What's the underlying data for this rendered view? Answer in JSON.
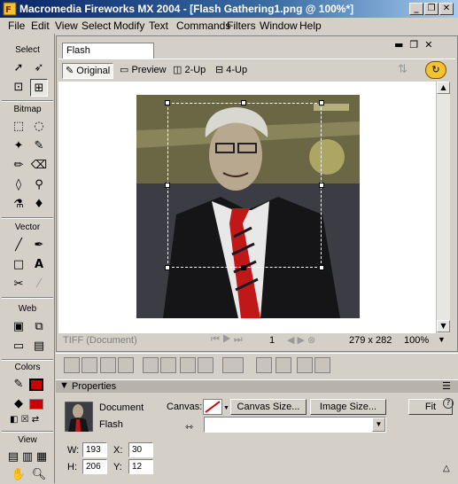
{
  "window": {
    "title": "Macromedia Fireworks MX 2004 - [Flash Gathering1.png @ 100%*]",
    "minimize_icon": "minimize-icon",
    "restore_icon": "restore-icon",
    "close_icon": "close-icon"
  },
  "menu": [
    "File",
    "Edit",
    "View",
    "Select",
    "Modify",
    "Text",
    "Commands",
    "Filters",
    "Window",
    "Help"
  ],
  "tools": {
    "sections": [
      "Select",
      "Bitmap",
      "Vector",
      "Web",
      "Colors",
      "View"
    ]
  },
  "document": {
    "tab": "Flash Gathering1.png*",
    "views": [
      "Original",
      "Preview",
      "2-Up",
      "4-Up"
    ],
    "status_left": "TIFF (Document)",
    "frame": "1",
    "dimensions": "279 x 282",
    "zoom": "100%"
  },
  "properties": {
    "header": "Properties",
    "type": "Document",
    "name": "Flash",
    "canvas_label": "Canvas:",
    "canvas_size_button": "Canvas Size...",
    "image_size_button": "Image Size...",
    "fit_button": "Fit",
    "w_label": "W:",
    "w_value": "193",
    "h_label": "H:",
    "h_value": "206",
    "x_label": "X:",
    "x_value": "30",
    "y_label": "Y:",
    "y_value": "12"
  },
  "colors": {
    "stroke": "#000000",
    "fill": "#cc0000",
    "title_gradient_start": "#0a246a"
  }
}
